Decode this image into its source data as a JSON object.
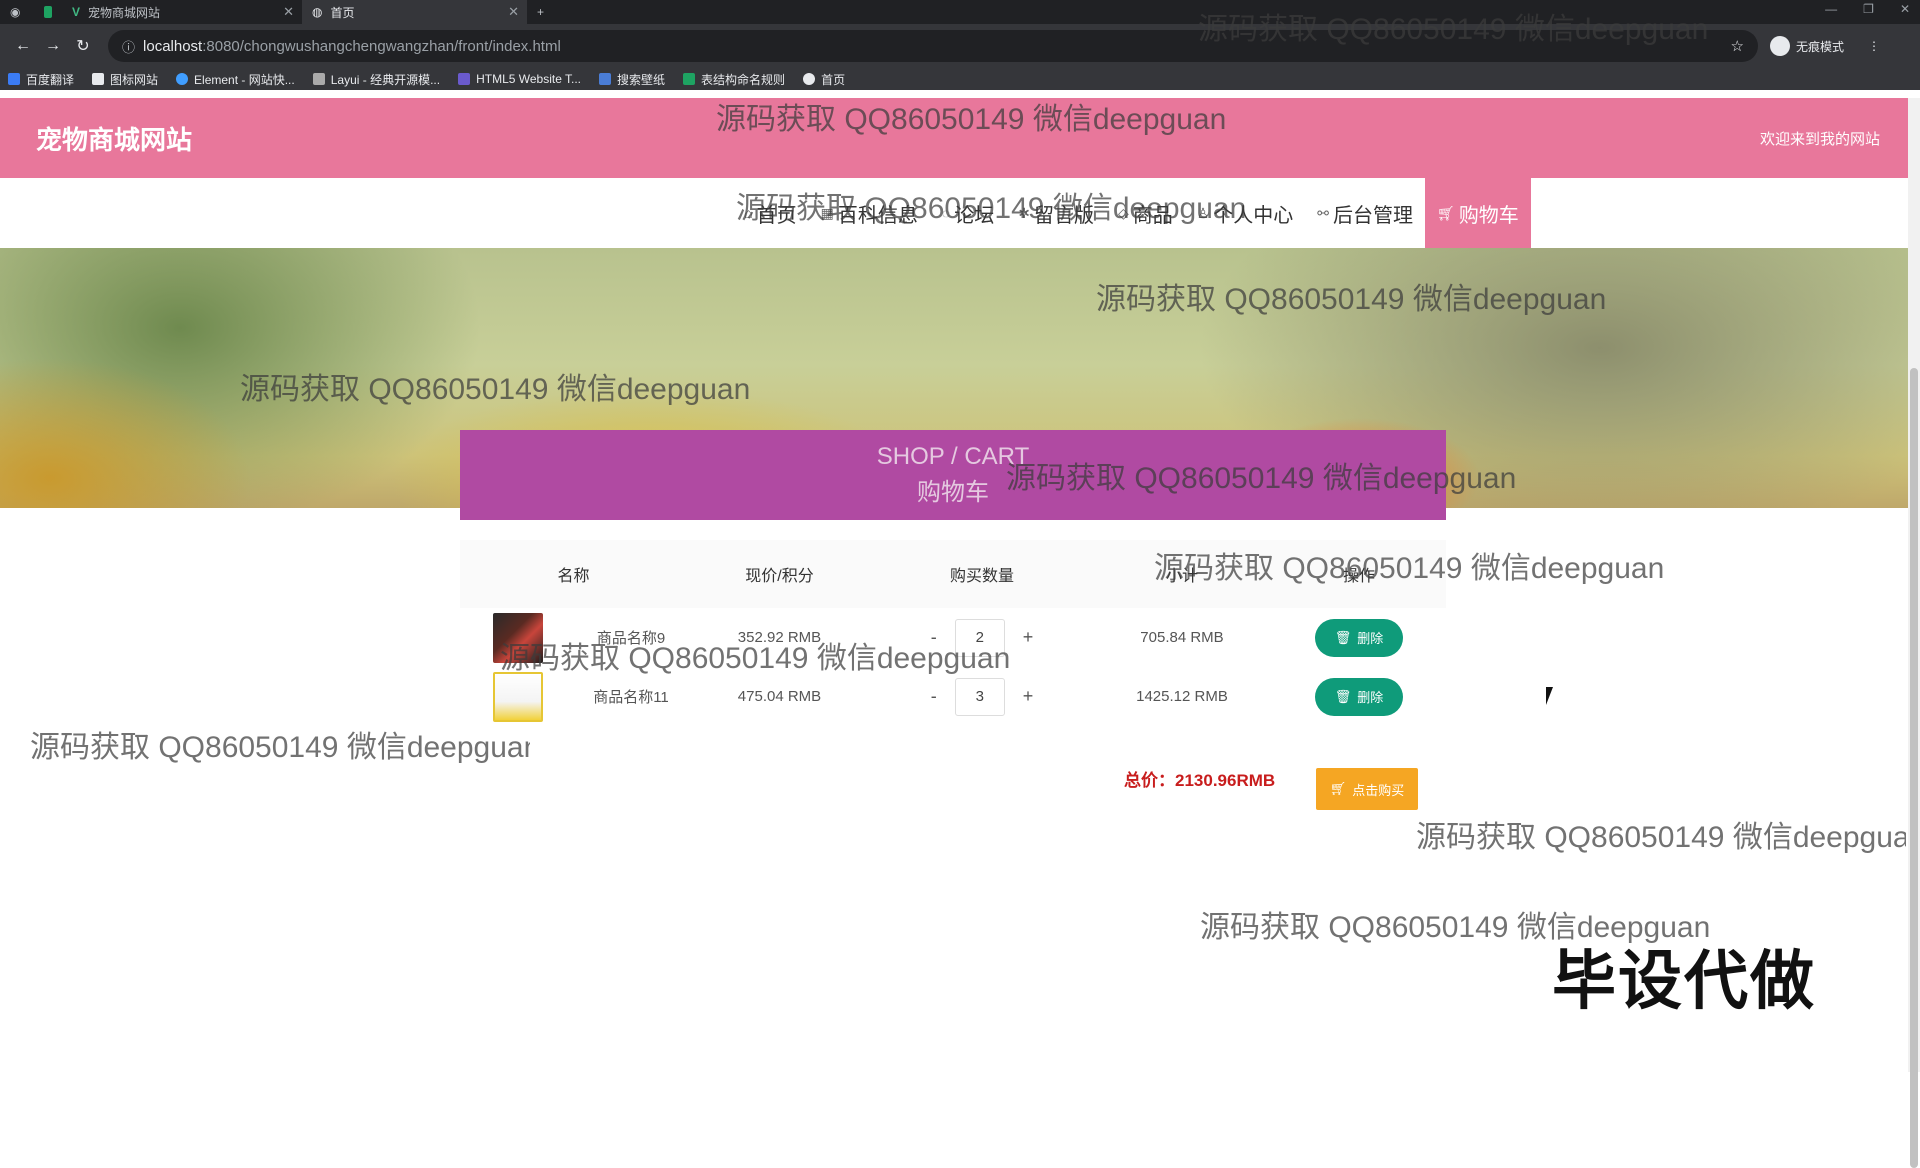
{
  "browser": {
    "tabs": [
      {
        "label": "宠物商城网站",
        "active": false
      },
      {
        "label": "首页",
        "active": true
      }
    ],
    "new_tab": "+",
    "url_host": "localhost",
    "url_path": ":8080/chongwushangchengwangzhan/front/index.html",
    "profile_label": "无痕模式",
    "bookmarks": [
      "百度翻译",
      "图标网站",
      "Element - 网站快...",
      "Layui - 经典开源模...",
      "HTML5 Website T...",
      "搜索壁纸",
      "表结构命名规则",
      "首页"
    ]
  },
  "header": {
    "logo": "宠物商城网站",
    "welcome": "欢迎来到我的网站"
  },
  "nav": {
    "items": [
      {
        "label": "首页",
        "icon": "home-icon",
        "active": false
      },
      {
        "label": "百科信息",
        "icon": "grid-icon",
        "active": false
      },
      {
        "label": "论坛",
        "icon": "chat-icon",
        "active": false
      },
      {
        "label": "留言版",
        "icon": "gear-icon",
        "active": false
      },
      {
        "label": "商品",
        "icon": "bag-icon",
        "active": false
      },
      {
        "label": "个人中心",
        "icon": "user-icon",
        "active": false
      },
      {
        "label": "后台管理",
        "icon": "link-icon",
        "active": false
      },
      {
        "label": "购物车",
        "icon": "cart-icon",
        "active": true
      }
    ]
  },
  "banner": {
    "slides": 3,
    "active_slide": 3
  },
  "cart": {
    "title_en": "SHOP / CART",
    "title_cn": "购物车",
    "columns": [
      "名称",
      "现价/积分",
      "购买数量",
      "小计",
      "操作"
    ],
    "rows": [
      {
        "name": "商品名称9",
        "price": "352.92 RMB",
        "qty": "2",
        "subtotal": "705.84 RMB",
        "action": "删除"
      },
      {
        "name": "商品名称11",
        "price": "475.04 RMB",
        "qty": "3",
        "subtotal": "1425.12 RMB",
        "action": "删除"
      }
    ],
    "minus": "-",
    "plus": "+",
    "total": "总价：2130.96RMB",
    "buy_label": "点击购买"
  },
  "watermark": "源码获取 QQ86050149 微信deepguan",
  "stamp": "毕设代做",
  "colors": {
    "header": "#e8779b",
    "cart_title": "#b04aa2",
    "delete": "#0f9b7a",
    "buy": "#f5a623",
    "total": "#c81d1d"
  }
}
